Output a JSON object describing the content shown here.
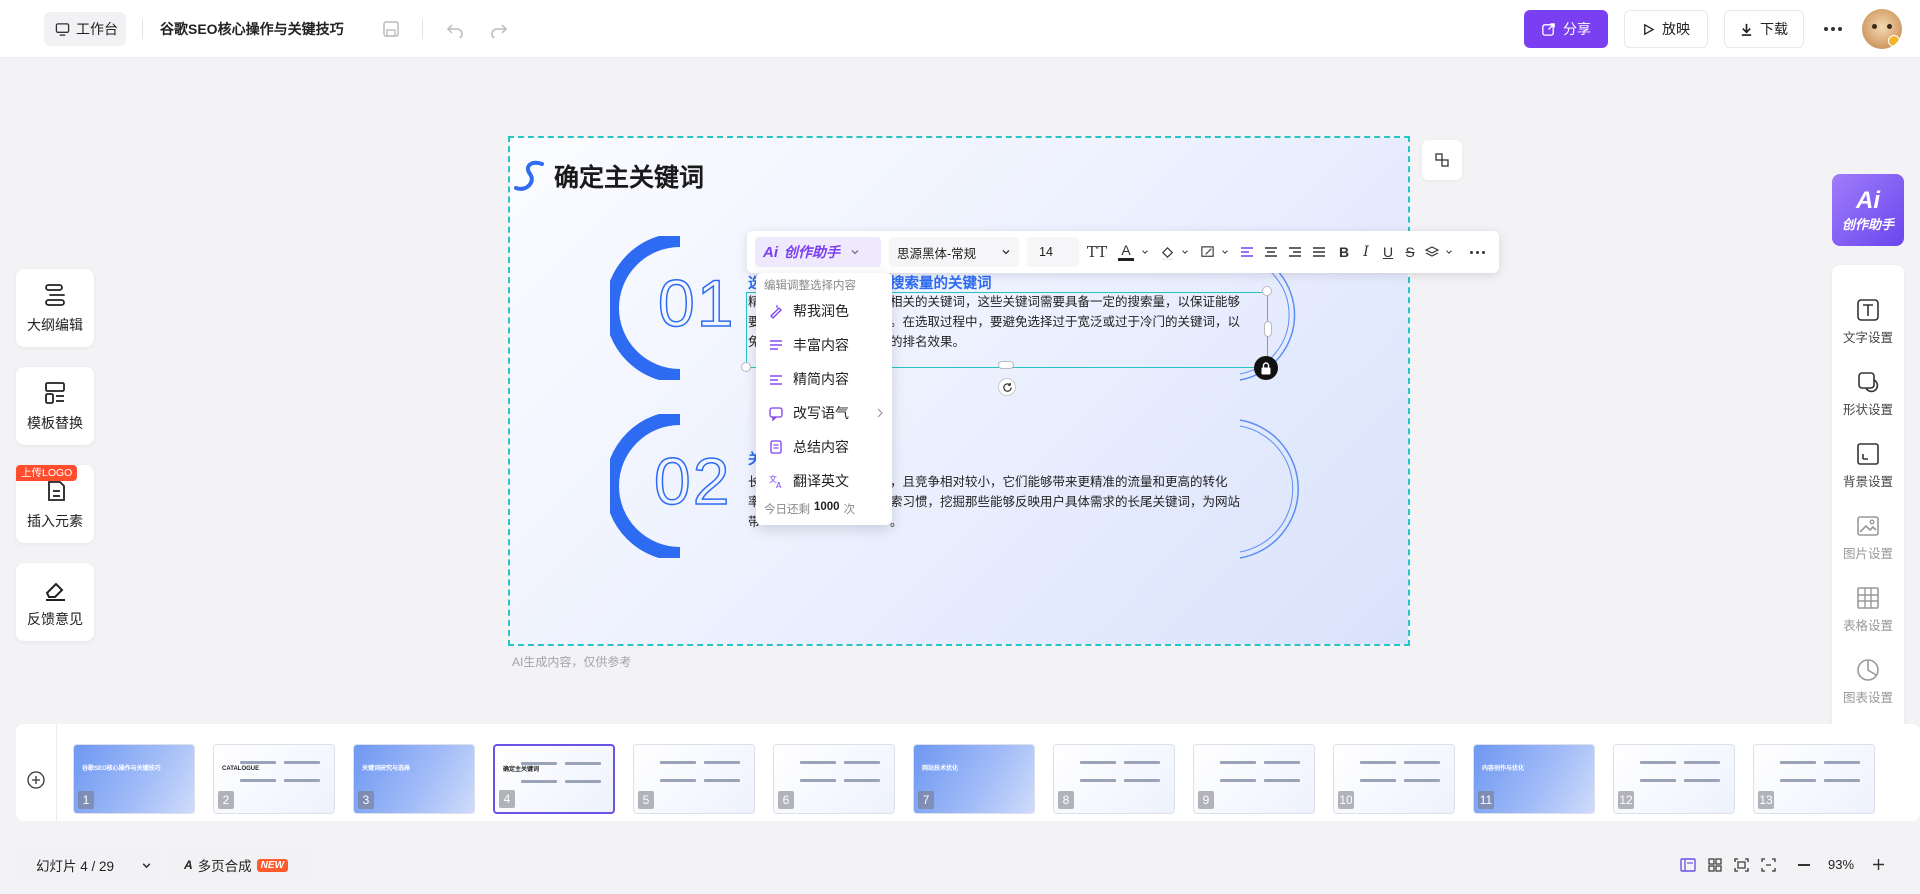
{
  "header": {
    "workspace_label": "工作台",
    "doc_title": "谷歌SEO核心操作与关键技巧",
    "share_label": "分享",
    "play_label": "放映",
    "download_label": "下载",
    "accent_color": "#7b3ff2"
  },
  "left_tools": [
    {
      "label": "大纲编辑",
      "icon": "outline-icon"
    },
    {
      "label": "模板替换",
      "icon": "template-icon"
    },
    {
      "label": "插入元素",
      "icon": "insert-icon",
      "badge": "上传LOGO"
    },
    {
      "label": "反馈意见",
      "icon": "feedback-icon"
    }
  ],
  "right_panel": {
    "ai_assistant_label": "创作助手",
    "items": [
      {
        "label": "文字设置",
        "icon": "text-settings-icon"
      },
      {
        "label": "形状设置",
        "icon": "shape-settings-icon"
      },
      {
        "label": "背景设置",
        "icon": "background-settings-icon"
      },
      {
        "label": "图片设置",
        "icon": "image-settings-icon"
      },
      {
        "label": "表格设置",
        "icon": "table-settings-icon"
      },
      {
        "label": "图表设置",
        "icon": "chart-settings-icon"
      }
    ]
  },
  "slide": {
    "title": "确定主关键词",
    "num1": "01",
    "num2": "02",
    "heading1_visible": "选",
    "heading1_tail": "搜索量的关键词",
    "item1_lines": [
      "精",
      "相关的关键词，这些关键词需要具备一定的搜索量，以保证能够",
      "要",
      "。在选取过程中，要避免选择过于宽泛或过于冷门的关键词，以",
      "免",
      "的排名效果。"
    ],
    "heading2_visible": "关",
    "item2_lines": [
      "长",
      "，且竞争相对较小，它们能够带来更精准的流量和更高的转化",
      "率",
      "索习惯，挖掘那些能够反映用户具体需求的长尾关键词，为网站",
      "带",
      "。"
    ],
    "note": "AI生成内容，仅供参考"
  },
  "format_toolbar": {
    "ai_button_label": "创作助手",
    "font_family": "思源黑体-常规",
    "font_size": "14"
  },
  "ai_menu": {
    "header": "编辑调整选择内容",
    "items": [
      {
        "label": "帮我润色",
        "icon": "polish-icon"
      },
      {
        "label": "丰富内容",
        "icon": "enrich-icon"
      },
      {
        "label": "精简内容",
        "icon": "simplify-icon"
      },
      {
        "label": "改写语气",
        "icon": "rewrite-tone-icon"
      },
      {
        "label": "总结内容",
        "icon": "summarize-icon"
      },
      {
        "label": "翻译英文",
        "icon": "translate-icon"
      }
    ],
    "quota_prefix": "今日还剩",
    "quota_value": "1000",
    "quota_suffix": "次"
  },
  "filmstrip": {
    "thumbs": [
      {
        "num": "1",
        "style": "blue",
        "title": "谷歌SEO核心操作与关键技巧"
      },
      {
        "num": "2",
        "style": "white",
        "title": "CATALOGUE"
      },
      {
        "num": "3",
        "style": "blue",
        "title": "关键词研究与选择"
      },
      {
        "num": "4",
        "style": "white",
        "title": "确定主关键词"
      },
      {
        "num": "5",
        "style": "white",
        "title": ""
      },
      {
        "num": "6",
        "style": "white",
        "title": ""
      },
      {
        "num": "7",
        "style": "blue",
        "title": "网站技术优化"
      },
      {
        "num": "8",
        "style": "white",
        "title": ""
      },
      {
        "num": "9",
        "style": "white",
        "title": ""
      },
      {
        "num": "10",
        "style": "white",
        "title": ""
      },
      {
        "num": "11",
        "style": "blue",
        "title": "内容创作与优化"
      },
      {
        "num": "12",
        "style": "white",
        "title": ""
      },
      {
        "num": "13",
        "style": "white",
        "title": ""
      }
    ],
    "selected_index": 3
  },
  "bottom": {
    "slide_counter": "幻灯片 4 / 29",
    "merge_label": "多页合成",
    "new_badge": "NEW",
    "zoom": "93%"
  }
}
